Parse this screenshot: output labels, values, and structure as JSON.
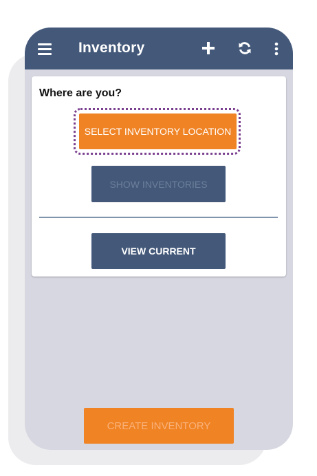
{
  "appbar": {
    "title": "Inventory",
    "icons": [
      "menu-icon",
      "add-icon",
      "refresh-icon",
      "more-vertical-icon"
    ]
  },
  "card": {
    "question": "Where are you?",
    "select_location_label": "SELECT INVENTORY LOCATION",
    "show_inventories_label": "SHOW INVENTORIES",
    "view_current_label": "VIEW CURRENT"
  },
  "footer": {
    "create_inventory_label": "CREATE INVENTORY"
  },
  "colors": {
    "appbar": "#44597a",
    "accent": "#f08324",
    "background": "#d6d7e1",
    "highlight": "#7b3f8f"
  }
}
